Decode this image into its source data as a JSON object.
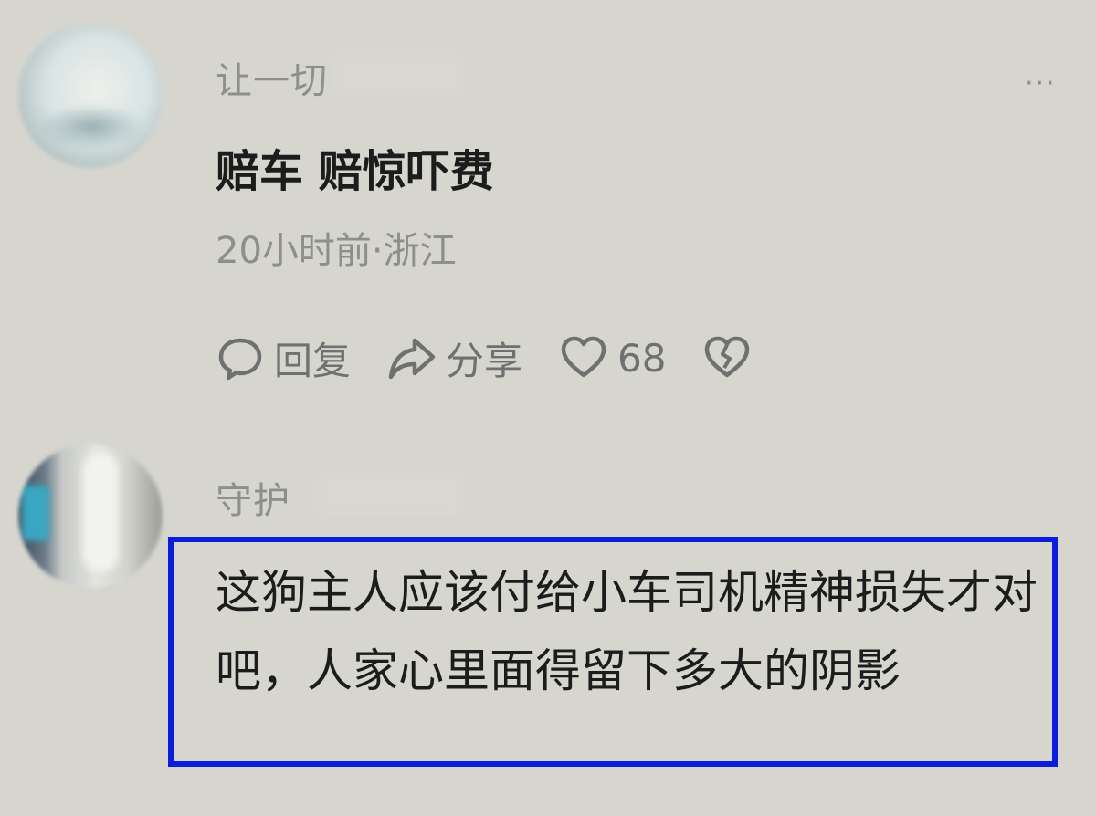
{
  "comments": [
    {
      "username": "让一切",
      "text": "赔车 赔惊吓费",
      "meta": "20小时前·浙江",
      "actions": {
        "reply_label": "回复",
        "share_label": "分享",
        "like_count": "68"
      },
      "more_label": "···"
    },
    {
      "username": "守护",
      "text": "这狗主人应该付给小车司机精神损失才对吧，人家心里面得留下多大的阴影"
    }
  ],
  "icons": {
    "reply": "chat-bubble-icon",
    "share": "share-arrow-icon",
    "like": "heart-icon",
    "dislike": "broken-heart-icon",
    "more": "more-dots-icon"
  },
  "colors": {
    "background": "#d6d6ce",
    "highlight_border": "#0a1ddc",
    "primary_text": "#1c1c1c",
    "secondary_text": "#8e8e8a"
  }
}
